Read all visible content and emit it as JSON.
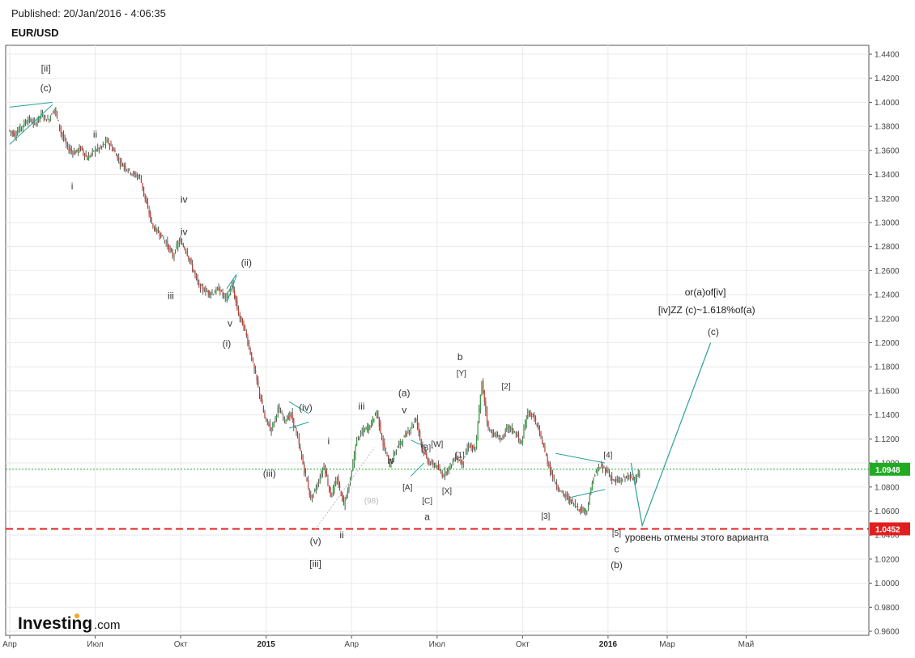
{
  "header": {
    "published": "Published: 20/Jan/2016 - 4:06:35",
    "symbol": "EUR/USD"
  },
  "brand": {
    "name": "Investing",
    "suffix": ".com"
  },
  "chart_data": {
    "type": "candlestick",
    "title": "EUR/USD",
    "ylim": [
      0.96,
      1.446
    ],
    "y_ticks": [
      "1.4400",
      "1.4200",
      "1.4000",
      "1.3800",
      "1.3600",
      "1.3400",
      "1.3200",
      "1.3000",
      "1.2800",
      "1.2600",
      "1.2400",
      "1.2200",
      "1.2000",
      "1.1800",
      "1.1600",
      "1.1400",
      "1.1200",
      "1.1000",
      "1.0800",
      "1.0600",
      "1.0400",
      "1.0200",
      "1.0000",
      "0.9800",
      "0.9600"
    ],
    "x_ticks": [
      {
        "label": "Апр",
        "week": 0
      },
      {
        "label": "Июл",
        "week": 13
      },
      {
        "label": "Окт",
        "week": 26
      },
      {
        "label": "2015",
        "week": 39,
        "bold": true
      },
      {
        "label": "Апр",
        "week": 52
      },
      {
        "label": "Июл",
        "week": 65
      },
      {
        "label": "Окт",
        "week": 78
      },
      {
        "label": "2016",
        "week": 91,
        "bold": true
      },
      {
        "label": "Мар",
        "week": 100
      },
      {
        "label": "Май",
        "week": 112
      }
    ],
    "series": [
      {
        "name": "EUR/USD",
        "closes": [
          1.373,
          1.38,
          1.386,
          1.382,
          1.39,
          1.385,
          1.395,
          1.375,
          1.362,
          1.358,
          1.362,
          1.353,
          1.36,
          1.362,
          1.368,
          1.36,
          1.35,
          1.345,
          1.34,
          1.338,
          1.315,
          1.296,
          1.291,
          1.283,
          1.272,
          1.285,
          1.277,
          1.262,
          1.247,
          1.243,
          1.241,
          1.245,
          1.237,
          1.248,
          1.224,
          1.21,
          1.187,
          1.163,
          1.137,
          1.128,
          1.145,
          1.136,
          1.14,
          1.12,
          1.094,
          1.07,
          1.082,
          1.098,
          1.073,
          1.086,
          1.066,
          1.086,
          1.12,
          1.127,
          1.131,
          1.143,
          1.115,
          1.098,
          1.112,
          1.12,
          1.128,
          1.137,
          1.111,
          1.1,
          1.098,
          1.09,
          1.096,
          1.105,
          1.1,
          1.115,
          1.11,
          1.167,
          1.128,
          1.123,
          1.12,
          1.13,
          1.126,
          1.116,
          1.143,
          1.137,
          1.121,
          1.101,
          1.085,
          1.076,
          1.071,
          1.066,
          1.061,
          1.061,
          1.089,
          1.097,
          1.094,
          1.085,
          1.085,
          1.089,
          1.087,
          1.091
        ]
      }
    ],
    "horizontal_lines": [
      {
        "value": 1.0948,
        "label": "1.0948",
        "color": "#22aa22",
        "style": "dotted"
      },
      {
        "value": 1.0452,
        "label": "1.0452",
        "color": "#e02020",
        "style": "dashed"
      }
    ],
    "projection": [
      {
        "week": 94.5,
        "value": 1.1
      },
      {
        "week": 96.2,
        "value": 1.048
      },
      {
        "week": 106.6,
        "value": 1.2
      }
    ],
    "annotations": [
      {
        "text": "[ii]",
        "week": 5.5,
        "value": 1.4255
      },
      {
        "text": "(c)",
        "week": 5.5,
        "value": 1.4095
      },
      {
        "text": "ii",
        "week": 13,
        "value": 1.3705
      },
      {
        "text": "i",
        "week": 9.5,
        "value": 1.3275
      },
      {
        "text": "iv",
        "week": 26.5,
        "value": 1.3165
      },
      {
        "text": "iv",
        "week": 26.5,
        "value": 1.2895
      },
      {
        "text": "iii",
        "week": 24.5,
        "value": 1.2365
      },
      {
        "text": "(ii)",
        "week": 36,
        "value": 1.264
      },
      {
        "text": "v",
        "week": 33.5,
        "value": 1.2135
      },
      {
        "text": "(i)",
        "week": 33,
        "value": 1.1965
      },
      {
        "text": "(iv)",
        "week": 45,
        "value": 1.1435
      },
      {
        "text": "(iii)",
        "week": 39.5,
        "value": 1.0885
      },
      {
        "text": "i",
        "week": 48.5,
        "value": 1.1155
      },
      {
        "text": "iii",
        "week": 53.5,
        "value": 1.1445
      },
      {
        "text": "(a)",
        "week": 60,
        "value": 1.1555
      },
      {
        "text": "v",
        "week": 60,
        "value": 1.1415
      },
      {
        "text": "b",
        "week": 68.5,
        "value": 1.1855
      },
      {
        "text": "(98)",
        "week": 55,
        "value": 1.0665,
        "faint": true
      },
      {
        "text": "iv",
        "week": 58,
        "value": 1.0995
      },
      {
        "text": "ii",
        "week": 50.5,
        "value": 1.0375
      },
      {
        "text": "(v)",
        "week": 46.5,
        "value": 1.0325
      },
      {
        "text": "[iii]",
        "week": 46.5,
        "value": 1.0135
      },
      {
        "text": "a",
        "week": 63.5,
        "value": 1.0525
      },
      {
        "text": "[A]",
        "week": 60.5,
        "value": 1.0775,
        "small": true
      },
      {
        "text": "[B]",
        "week": 63.3,
        "value": 1.1105,
        "small": true
      },
      {
        "text": "[W]",
        "week": 65,
        "value": 1.1135,
        "small": true
      },
      {
        "text": "[C]",
        "week": 63.5,
        "value": 1.0665,
        "small": true
      },
      {
        "text": "[X]",
        "week": 66.5,
        "value": 1.0745,
        "small": true
      },
      {
        "text": "[Y]",
        "week": 68.7,
        "value": 1.1725,
        "small": true
      },
      {
        "text": "[1]",
        "week": 68.5,
        "value": 1.1045,
        "small": true
      },
      {
        "text": "[2]",
        "week": 75.5,
        "value": 1.1615,
        "small": true
      },
      {
        "text": "[3]",
        "week": 81.5,
        "value": 1.0535,
        "small": true
      },
      {
        "text": "[4]",
        "week": 91,
        "value": 1.1045,
        "small": true
      },
      {
        "text": "[5]",
        "week": 92.3,
        "value": 1.0395,
        "small": true
      },
      {
        "text": "c",
        "week": 92.3,
        "value": 1.0255
      },
      {
        "text": "(b)",
        "week": 92.3,
        "value": 1.0125
      },
      {
        "text": "or(a)of[iv]",
        "week": 105.8,
        "value": 1.2395,
        "dark": true
      },
      {
        "text": "[iv]ZZ (c)~1.618%of(a)",
        "week": 106,
        "value": 1.2245,
        "dark": true
      },
      {
        "text": "(c)",
        "week": 107,
        "value": 1.2065
      },
      {
        "text": "уровень отмены этого варианта",
        "week": 104.5,
        "value": 1.0355,
        "dark": true
      }
    ],
    "pattern_lines": [
      [
        [
          0,
          1.396
        ],
        [
          6.5,
          1.4
        ]
      ],
      [
        [
          0,
          1.365
        ],
        [
          6.5,
          1.398
        ]
      ],
      [
        [
          33,
          1.245
        ],
        [
          34.5,
          1.257
        ]
      ],
      [
        [
          33,
          1.233
        ],
        [
          34.5,
          1.256
        ]
      ],
      [
        [
          42.5,
          1.151
        ],
        [
          45.5,
          1.141
        ]
      ],
      [
        [
          42.5,
          1.129
        ],
        [
          45.5,
          1.134
        ]
      ],
      [
        [
          61,
          1.119
        ],
        [
          63,
          1.114
        ]
      ],
      [
        [
          61,
          1.089
        ],
        [
          63,
          1.1
        ]
      ],
      [
        [
          83,
          1.108
        ],
        [
          90.5,
          1.1
        ]
      ],
      [
        [
          85,
          1.071
        ],
        [
          90.5,
          1.078
        ]
      ]
    ],
    "grid": true,
    "legend": "none"
  }
}
